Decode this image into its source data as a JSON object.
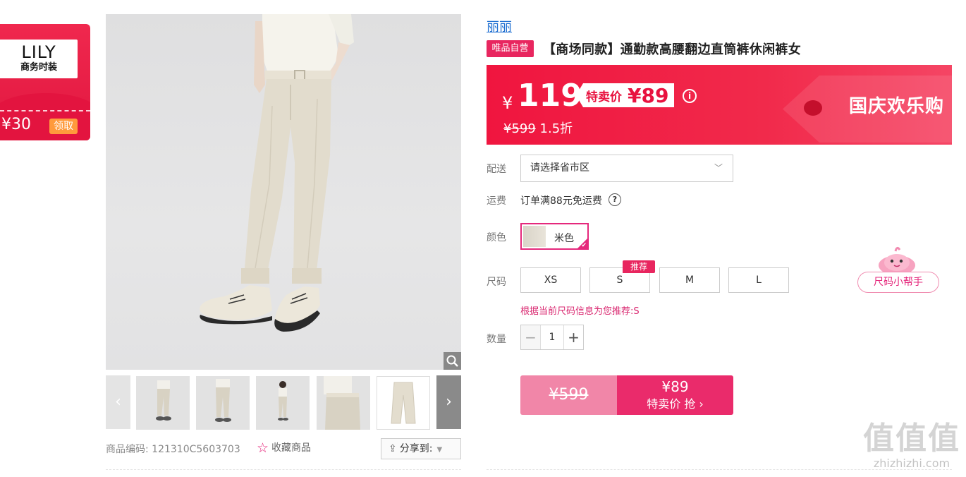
{
  "coupon": {
    "brand_logo": "LILY",
    "brand_sub": "商务时装",
    "amount": "¥30",
    "claim_label": "领取"
  },
  "gallery": {
    "prev_arrow": "‹",
    "next_arrow": "›",
    "thumbnails_count": 5,
    "zoom_icon": "magnifier-icon"
  },
  "meta": {
    "sku_label": "商品编码:",
    "sku_value": "121310C5603703",
    "favorite_label": "收藏商品",
    "share_label": "分享到:"
  },
  "product": {
    "brand": "丽丽",
    "self_badge": "唯品自营",
    "title": "【商场同款】通勤款高腰翻边直筒裤休闲裤女"
  },
  "price": {
    "currency": "¥",
    "current": "119",
    "special_label": "特卖价",
    "special_value": "¥89",
    "original": "¥599",
    "discount": "1.5折",
    "promo": "国庆欢乐购"
  },
  "delivery": {
    "label": "配送",
    "placeholder": "请选择省市区"
  },
  "freight": {
    "label": "运费",
    "text": "订单满88元免运费",
    "help": "?"
  },
  "color": {
    "label": "颜色",
    "option": "米色"
  },
  "size": {
    "label": "尺码",
    "options": [
      "XS",
      "S",
      "M",
      "L"
    ],
    "recommend_badge": "推荐",
    "hint": "根据当前尺码信息为您推荐:S",
    "helper": "尺码小帮手"
  },
  "quantity": {
    "label": "数量",
    "minus": "−",
    "value": "1",
    "plus": "+"
  },
  "buy": {
    "original": "¥599",
    "price": "¥89",
    "action": "特卖价 抢 ›"
  },
  "watermark": {
    "main": "值值值",
    "sub": "zhizhizhi.com"
  },
  "colors": {
    "accent": "#e5287c",
    "banner_red": "#f0153f",
    "brand_blue": "#1f6fd1"
  }
}
